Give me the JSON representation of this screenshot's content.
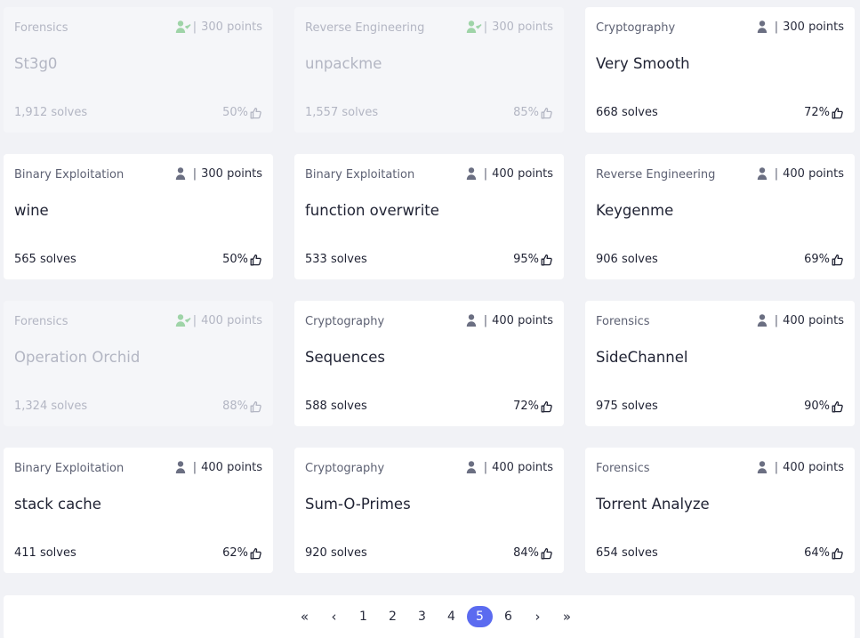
{
  "challenges": [
    {
      "category": "Forensics",
      "points": "300 points",
      "name": "St3g0",
      "solves": "1,912 solves",
      "rating": "50%",
      "solved": true
    },
    {
      "category": "Reverse Engineering",
      "points": "300 points",
      "name": "unpackme",
      "solves": "1,557 solves",
      "rating": "85%",
      "solved": true
    },
    {
      "category": "Cryptography",
      "points": "300 points",
      "name": "Very Smooth",
      "solves": "668 solves",
      "rating": "72%",
      "solved": false
    },
    {
      "category": "Binary Exploitation",
      "points": "300 points",
      "name": "wine",
      "solves": "565 solves",
      "rating": "50%",
      "solved": false
    },
    {
      "category": "Binary Exploitation",
      "points": "400 points",
      "name": "function overwrite",
      "solves": "533 solves",
      "rating": "95%",
      "solved": false
    },
    {
      "category": "Reverse Engineering",
      "points": "400 points",
      "name": "Keygenme",
      "solves": "906 solves",
      "rating": "69%",
      "solved": false
    },
    {
      "category": "Forensics",
      "points": "400 points",
      "name": "Operation Orchid",
      "solves": "1,324 solves",
      "rating": "88%",
      "solved": true
    },
    {
      "category": "Cryptography",
      "points": "400 points",
      "name": "Sequences",
      "solves": "588 solves",
      "rating": "72%",
      "solved": false
    },
    {
      "category": "Forensics",
      "points": "400 points",
      "name": "SideChannel",
      "solves": "975 solves",
      "rating": "90%",
      "solved": false
    },
    {
      "category": "Binary Exploitation",
      "points": "400 points",
      "name": "stack cache",
      "solves": "411 solves",
      "rating": "62%",
      "solved": false
    },
    {
      "category": "Cryptography",
      "points": "400 points",
      "name": "Sum-O-Primes",
      "solves": "920 solves",
      "rating": "84%",
      "solved": false
    },
    {
      "category": "Forensics",
      "points": "400 points",
      "name": "Torrent Analyze",
      "solves": "654 solves",
      "rating": "64%",
      "solved": false
    }
  ],
  "icons": {
    "points": "user-icon",
    "solved_points": "user-check-icon",
    "rating": "thumbs-up-icon"
  },
  "pagination": {
    "first": "«",
    "prev": "‹",
    "pages": [
      "1",
      "2",
      "3",
      "4",
      "5",
      "6"
    ],
    "current": "5",
    "next": "›",
    "last": "»"
  },
  "colors": {
    "accent": "#5b6bf0",
    "solved_check": "#9fd4a8",
    "card_bg": "#ffffff",
    "solved_card_bg": "#f5f6f9",
    "page_bg": "#f1f2f6"
  }
}
